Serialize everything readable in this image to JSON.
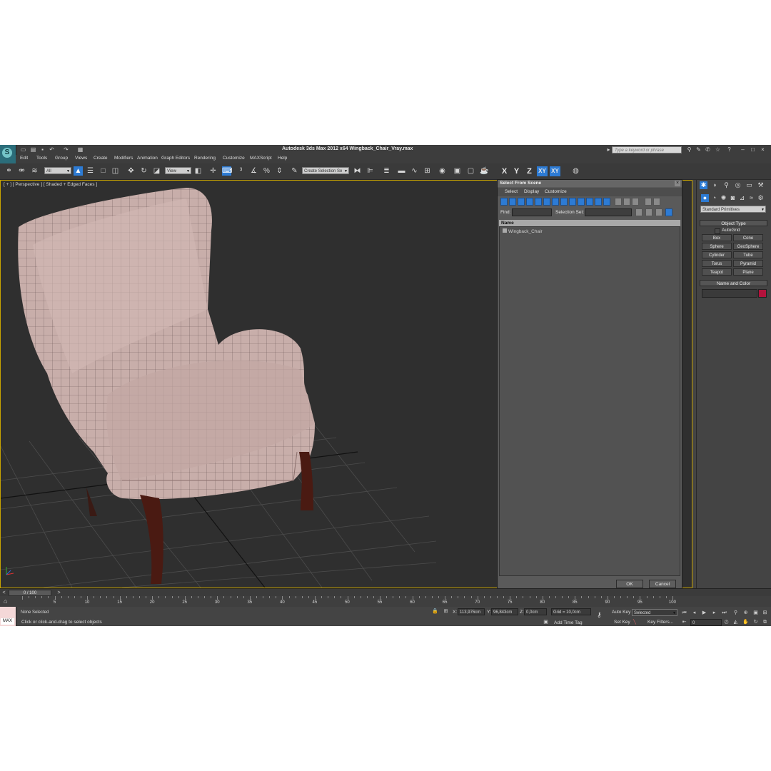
{
  "app": {
    "title": "Autodesk 3ds Max  2012 x64     Wingback_Chair_Vray.max",
    "search_placeholder": "Type a keyword or phrase",
    "logo": "3ds-max-logo"
  },
  "menus": [
    "Edit",
    "Tools",
    "Group",
    "Views",
    "Create",
    "Modifiers",
    "Animation",
    "Graph Editors",
    "Rendering",
    "Customize",
    "MAXScript",
    "Help"
  ],
  "toolbar": {
    "filter_value": "All",
    "refcoord_value": "View",
    "selection_set_value": "Create Selection Se",
    "axes": [
      "X",
      "Y",
      "Z",
      "XY",
      "XY"
    ]
  },
  "viewport": {
    "label": "[ + ] [ Perspective ] [ Shaded + Edged Faces ]"
  },
  "dialog": {
    "title": "Select From Scene",
    "menus": [
      "Select",
      "Display",
      "Customize"
    ],
    "find_label": "Find:",
    "selection_set_label": "Selection Set:",
    "column_name": "Name",
    "items": [
      "Wingback_Chair"
    ],
    "ok": "OK",
    "cancel": "Cancel"
  },
  "command_panel": {
    "category": "Standard Primitives",
    "object_type_title": "Object Type",
    "autogrid_label": "AutoGrid",
    "primitives": [
      "Box",
      "Cone",
      "Sphere",
      "GeoSphere",
      "Cylinder",
      "Tube",
      "Torus",
      "Pyramid",
      "Teapot",
      "Plane"
    ],
    "name_color_title": "Name and Color",
    "object_color": "#b3123c"
  },
  "timeline": {
    "frame_display": "0 / 100",
    "ticks": [
      "5",
      "10",
      "15",
      "20",
      "25",
      "30",
      "35",
      "40",
      "45",
      "50",
      "55",
      "60",
      "65",
      "70",
      "75",
      "80",
      "85",
      "90",
      "95",
      "100"
    ]
  },
  "status": {
    "max_label": "MAX",
    "selection": "None Selected",
    "prompt": "Click or click-and-drag to select objects",
    "x_label": "X:",
    "x_value": "113,976cm",
    "y_label": "Y:",
    "y_value": "96,843cm",
    "z_label": "Z:",
    "z_value": "0,0cm",
    "grid": "Grid = 10,0cm",
    "add_time_tag": "Add Time Tag",
    "auto_key": "Auto Key",
    "auto_key_value": "Selected",
    "set_key": "Set Key",
    "key_filters": "Key Filters...",
    "frame_value": "0"
  }
}
